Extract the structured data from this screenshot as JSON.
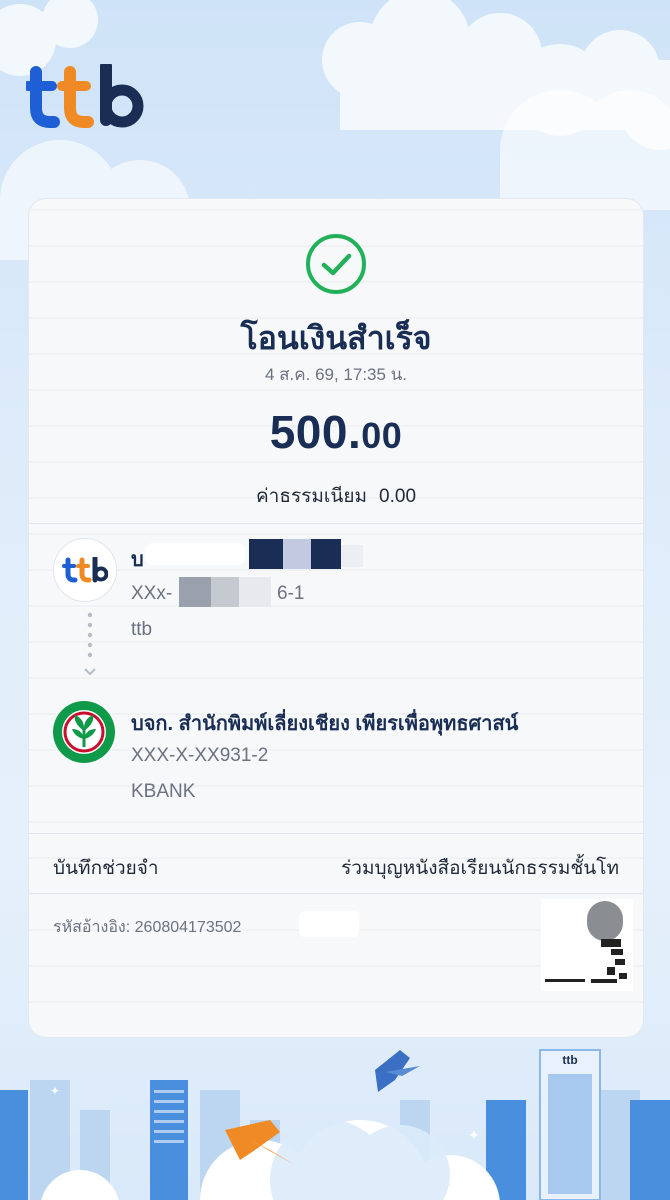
{
  "brand": {
    "logo_text": "ttb"
  },
  "status": {
    "title": "โอนเงินสำเร็จ",
    "datetime": "4 ส.ค. 69, 17:35 น."
  },
  "amount": {
    "whole": "500.",
    "decimal": "00"
  },
  "fee": {
    "label": "ค่าธรรมเนียม",
    "value": "0.00"
  },
  "sender": {
    "name": "บ",
    "account": "XXx-",
    "account_suffix": "6-1",
    "bank": "ttb"
  },
  "receiver": {
    "name": "บจก. สำนักพิมพ์เลี่ยงเชียง เพียรเพื่อพุทธศาสน์",
    "account": "XXX-X-XX931-2",
    "bank": "KBANK"
  },
  "memo": {
    "label": "บันทึกช่วยจำ",
    "value": "ร่วมบุญหนังสือเรียนนักธรรมชั้นโท"
  },
  "reference": {
    "label": "รหัสอ้างอิง:",
    "value": "260804173502"
  },
  "colors": {
    "brand_navy": "#1a2e55",
    "brand_orange": "#f08a24",
    "brand_blue": "#1f5fd6",
    "success_green": "#22b05a"
  }
}
